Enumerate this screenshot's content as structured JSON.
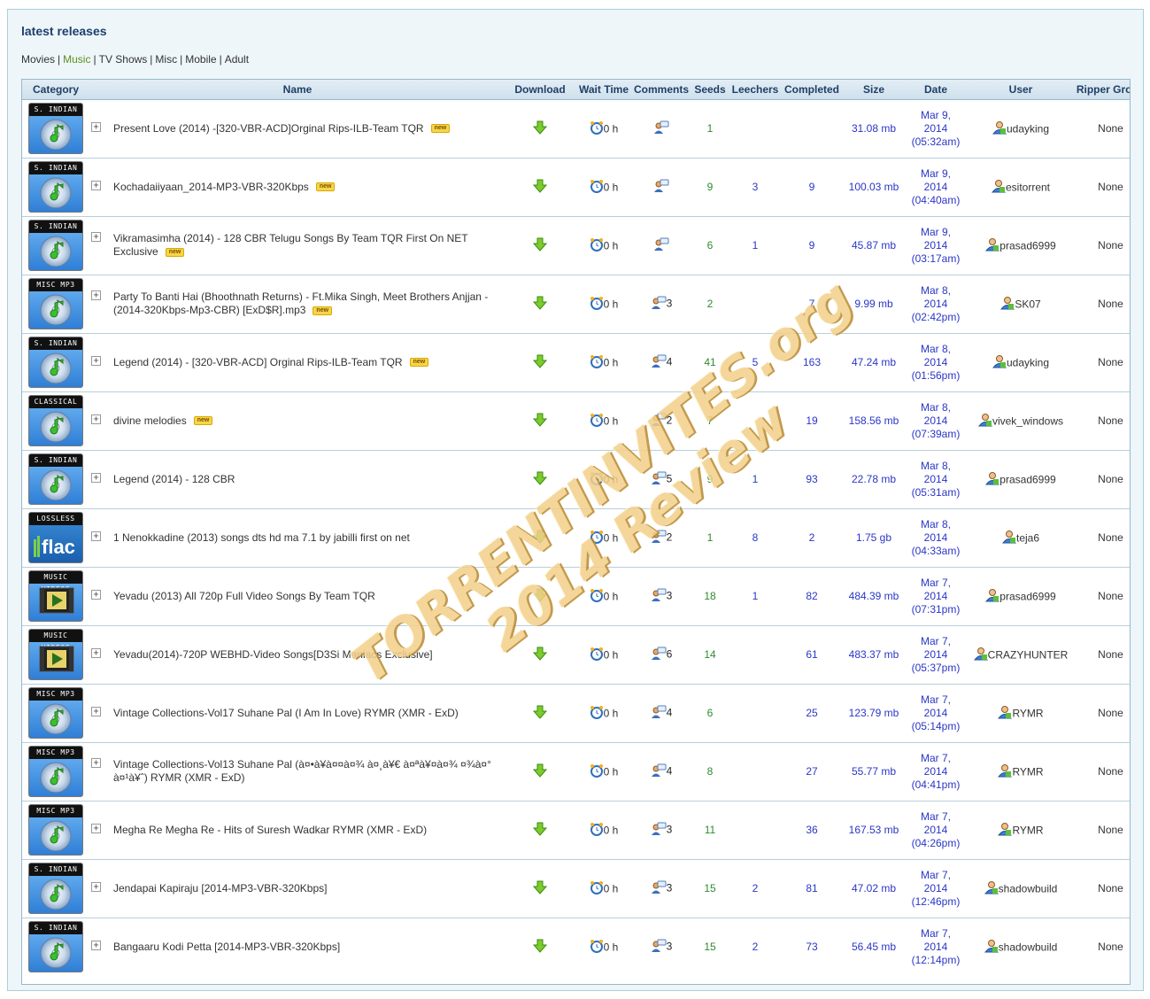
{
  "section_title": "latest releases",
  "categories_nav": [
    {
      "label": "Movies",
      "active": false
    },
    {
      "label": "Music",
      "active": true
    },
    {
      "label": "TV Shows",
      "active": false
    },
    {
      "label": "Misc",
      "active": false
    },
    {
      "label": "Mobile",
      "active": false
    },
    {
      "label": "Adult",
      "active": false
    }
  ],
  "columns": [
    "Category",
    "Name",
    "Download",
    "Wait Time",
    "Comments",
    "Seeds",
    "Leechers",
    "Completed",
    "Size",
    "Date",
    "User",
    "Ripper Group"
  ],
  "colors": {
    "seeds": "#2e8b2e",
    "link_blue": "#2a36c6",
    "header_text": "#1f3f66",
    "active_nav": "#5a8f1e"
  },
  "rows": [
    {
      "category": "S. INDIAN",
      "icon": "music-disc-icon",
      "name": "Present Love (2014) -[320-VBR-ACD]Orginal Rips-ILB-Team TQR",
      "is_new": true,
      "new_label": "new",
      "wait": "0 h",
      "comments": "",
      "seeds": "1",
      "leechers": "",
      "completed": "",
      "size": "31.08 mb",
      "date_line1": "Mar 9,",
      "date_line2": "2014",
      "date_line3": "(05:32am)",
      "user": "udayking",
      "ripper": "None"
    },
    {
      "category": "S. INDIAN",
      "icon": "music-disc-icon",
      "name": "Kochadaiiyaan_2014-MP3-VBR-320Kbps",
      "is_new": true,
      "new_label": "new",
      "wait": "0 h",
      "comments": "",
      "seeds": "9",
      "leechers": "3",
      "completed": "9",
      "size": "100.03 mb",
      "date_line1": "Mar 9,",
      "date_line2": "2014",
      "date_line3": "(04:40am)",
      "user": "esitorrent",
      "ripper": "None"
    },
    {
      "category": "S. INDIAN",
      "icon": "music-disc-icon",
      "name": "Vikramasimha (2014) - 128 CBR Telugu Songs By Team TQR First On NET Exclusive",
      "is_new": true,
      "new_label": "new",
      "wait": "0 h",
      "comments": "",
      "seeds": "6",
      "leechers": "1",
      "completed": "9",
      "size": "45.87 mb",
      "date_line1": "Mar 9,",
      "date_line2": "2014",
      "date_line3": "(03:17am)",
      "user": "prasad6999",
      "ripper": "None"
    },
    {
      "category": "MISC MP3",
      "icon": "music-disc-icon",
      "name": "Party To Banti Hai (Bhoothnath Returns) - Ft.Mika Singh, Meet Brothers Anjjan - (2014-320Kbps-Mp3-CBR) [ExD$R].mp3",
      "is_new": true,
      "new_label": "new",
      "wait": "0 h",
      "comments": "3",
      "seeds": "2",
      "leechers": "",
      "completed": "7",
      "size": "9.99 mb",
      "date_line1": "Mar 8,",
      "date_line2": "2014",
      "date_line3": "(02:42pm)",
      "user": "SK07",
      "ripper": "None"
    },
    {
      "category": "S. INDIAN",
      "icon": "music-disc-icon",
      "name": "Legend (2014) - [320-VBR-ACD] Orginal Rips-ILB-Team TQR",
      "is_new": true,
      "new_label": "new",
      "wait": "0 h",
      "comments": "4",
      "seeds": "41",
      "leechers": "5",
      "completed": "163",
      "size": "47.24 mb",
      "date_line1": "Mar 8,",
      "date_line2": "2014",
      "date_line3": "(01:56pm)",
      "user": "udayking",
      "ripper": "None"
    },
    {
      "category": "CLASSICAL",
      "icon": "music-disc-icon",
      "name": "divine melodies",
      "is_new": true,
      "new_label": "new",
      "wait": "0 h",
      "comments": "2",
      "seeds": "7",
      "leechers": "",
      "completed": "19",
      "size": "158.56 mb",
      "date_line1": "Mar 8,",
      "date_line2": "2014",
      "date_line3": "(07:39am)",
      "user": "vivek_windows",
      "ripper": "None"
    },
    {
      "category": "S. INDIAN",
      "icon": "music-disc-icon",
      "name": "Legend (2014) - 128 CBR",
      "is_new": false,
      "new_label": "",
      "wait": "0 h",
      "comments": "5",
      "seeds": "9",
      "leechers": "1",
      "completed": "93",
      "size": "22.78 mb",
      "date_line1": "Mar 8,",
      "date_line2": "2014",
      "date_line3": "(05:31am)",
      "user": "prasad6999",
      "ripper": "None"
    },
    {
      "category": "LOSSLESS",
      "icon": "flac-icon",
      "name": "1 Nenokkadine (2013) songs dts hd ma 7.1 by jabilli first on net",
      "is_new": false,
      "new_label": "",
      "wait": "0 h",
      "comments": "2",
      "seeds": "1",
      "leechers": "8",
      "completed": "2",
      "size": "1.75 gb",
      "date_line1": "Mar 8,",
      "date_line2": "2014",
      "date_line3": "(04:33am)",
      "user": "teja6",
      "ripper": "None"
    },
    {
      "category": "MUSIC VIDEOS",
      "icon": "video-icon",
      "name": "Yevadu (2013) All 720p Full Video Songs By Team TQR",
      "is_new": false,
      "new_label": "",
      "wait": "0 h",
      "comments": "3",
      "seeds": "18",
      "leechers": "1",
      "completed": "82",
      "size": "484.39 mb",
      "date_line1": "Mar 7,",
      "date_line2": "2014",
      "date_line3": "(07:31pm)",
      "user": "prasad6999",
      "ripper": "None"
    },
    {
      "category": "MUSIC VIDEOS",
      "icon": "video-icon",
      "name": "Yevadu(2014)-720P WEBHD-Video Songs[D3Si Maniacs Exclusive]",
      "is_new": false,
      "new_label": "",
      "wait": "0 h",
      "comments": "6",
      "seeds": "14",
      "leechers": "",
      "completed": "61",
      "size": "483.37 mb",
      "date_line1": "Mar 7,",
      "date_line2": "2014",
      "date_line3": "(05:37pm)",
      "user": "CRAZYHUNTER",
      "ripper": "None"
    },
    {
      "category": "MISC MP3",
      "icon": "music-disc-icon",
      "name": "Vintage Collections-Vol17 Suhane Pal (I Am In Love) RYMR (XMR - ExD)",
      "is_new": false,
      "new_label": "",
      "wait": "0 h",
      "comments": "4",
      "seeds": "6",
      "leechers": "",
      "completed": "25",
      "size": "123.79 mb",
      "date_line1": "Mar 7,",
      "date_line2": "2014",
      "date_line3": "(05:14pm)",
      "user": "RYMR",
      "ripper": "None"
    },
    {
      "category": "MISC MP3",
      "icon": "music-disc-icon",
      "name": "Vintage Collections-Vol13 Suhane Pal (à¤•à¥à¤¤à¤¾ à¤¸à¥€ à¤ªà¥¤à¤¾ ¤¾à¤° à¤¹à¥ˆ) RYMR (XMR - ExD)",
      "is_new": false,
      "new_label": "",
      "wait": "0 h",
      "comments": "4",
      "seeds": "8",
      "leechers": "",
      "completed": "27",
      "size": "55.77 mb",
      "date_line1": "Mar 7,",
      "date_line2": "2014",
      "date_line3": "(04:41pm)",
      "user": "RYMR",
      "ripper": "None"
    },
    {
      "category": "MISC MP3",
      "icon": "music-disc-icon",
      "name": "Megha Re Megha Re - Hits of Suresh Wadkar RYMR (XMR - ExD)",
      "is_new": false,
      "new_label": "",
      "wait": "0 h",
      "comments": "3",
      "seeds": "11",
      "leechers": "",
      "completed": "36",
      "size": "167.53 mb",
      "date_line1": "Mar 7,",
      "date_line2": "2014",
      "date_line3": "(04:26pm)",
      "user": "RYMR",
      "ripper": "None"
    },
    {
      "category": "S. INDIAN",
      "icon": "music-disc-icon",
      "name": "Jendapai Kapiraju [2014-MP3-VBR-320Kbps]",
      "is_new": false,
      "new_label": "",
      "wait": "0 h",
      "comments": "3",
      "seeds": "15",
      "leechers": "2",
      "completed": "81",
      "size": "47.02 mb",
      "date_line1": "Mar 7,",
      "date_line2": "2014",
      "date_line3": "(12:46pm)",
      "user": "shadowbuild",
      "ripper": "None"
    },
    {
      "category": "S. INDIAN",
      "icon": "music-disc-icon",
      "name": "Bangaaru Kodi Petta [2014-MP3-VBR-320Kbps]",
      "is_new": false,
      "new_label": "",
      "wait": "0 h",
      "comments": "3",
      "seeds": "15",
      "leechers": "2",
      "completed": "73",
      "size": "56.45 mb",
      "date_line1": "Mar 7,",
      "date_line2": "2014",
      "date_line3": "(12:14pm)",
      "user": "shadowbuild",
      "ripper": "None"
    }
  ],
  "watermark": {
    "line1": "TORRENTINVITES.org",
    "line2": "2014 Review"
  }
}
